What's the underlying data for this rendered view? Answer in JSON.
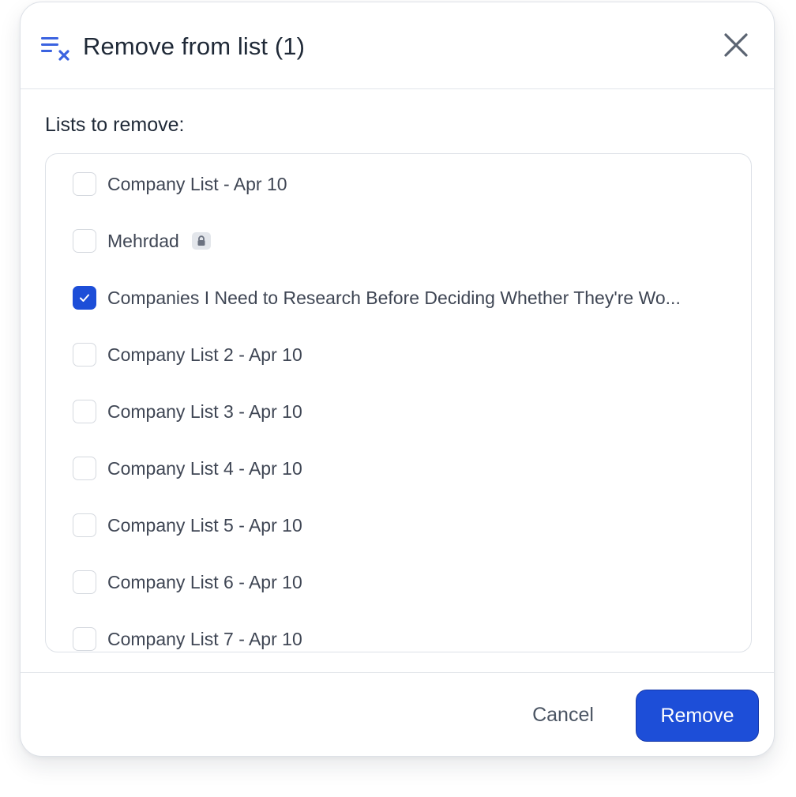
{
  "modal": {
    "title": "Remove from list (1)",
    "header_icon": "playlist-remove-icon",
    "close_icon": "close-icon"
  },
  "body": {
    "label": "Lists to remove:"
  },
  "lists": [
    {
      "label": "Company List -  Apr 10",
      "checked": false,
      "locked": false
    },
    {
      "label": "Mehrdad",
      "checked": false,
      "locked": true
    },
    {
      "label": "Companies I Need to Research Before Deciding Whether They're Wo...",
      "checked": true,
      "locked": false
    },
    {
      "label": "Company List 2 -  Apr 10",
      "checked": false,
      "locked": false
    },
    {
      "label": "Company List 3 -  Apr 10",
      "checked": false,
      "locked": false
    },
    {
      "label": "Company List 4 -  Apr 10",
      "checked": false,
      "locked": false
    },
    {
      "label": "Company List 5 -  Apr 10",
      "checked": false,
      "locked": false
    },
    {
      "label": "Company List 6 -  Apr 10",
      "checked": false,
      "locked": false
    },
    {
      "label": "Company List 7 -  Apr 10",
      "checked": false,
      "locked": false
    }
  ],
  "footer": {
    "cancel_label": "Cancel",
    "remove_label": "Remove"
  },
  "colors": {
    "accent": "#1d4ed8",
    "text": "#1f2937",
    "muted": "#4b5563"
  }
}
